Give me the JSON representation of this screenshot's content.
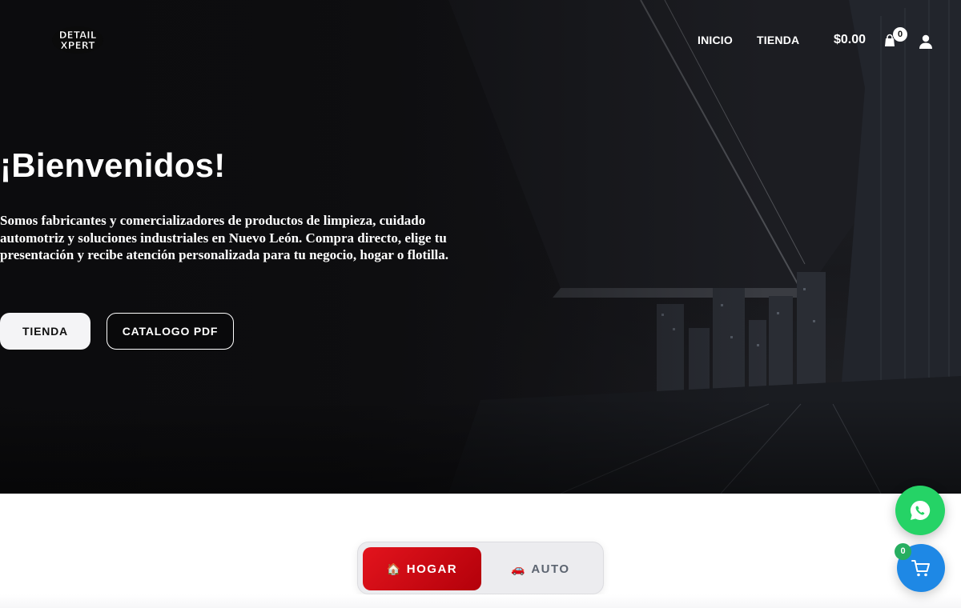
{
  "header": {
    "logo_text": "DETAIL XPERT",
    "nav": [
      {
        "label": "INICIO"
      },
      {
        "label": "TIENDA"
      }
    ],
    "cart_total": "$0.00",
    "cart_count": "0",
    "icons": [
      "shopping-bag-icon",
      "user-icon"
    ]
  },
  "hero": {
    "title": "¡Bienvenidos!",
    "description": "Somos fabricantes y comercializadores de productos de limpieza, cuidado automotriz y soluciones industriales en Nuevo León. Compra directo, elige tu presentación y recibe atención personalizada para tu negocio, hogar o flotilla.",
    "buttons": {
      "shop": "TIENDA",
      "catalog": "CATALOGO PDF"
    }
  },
  "tabs": {
    "items": [
      {
        "emoji": "🏠",
        "label": "HOGAR",
        "active": true
      },
      {
        "emoji": "🚗",
        "label": "AUTO",
        "active": false
      }
    ]
  },
  "floating": {
    "whatsapp_icon": "whatsapp-icon",
    "cart_icon": "cart-icon",
    "cart_count": "0"
  },
  "colors": {
    "accent_red": "#d60a14",
    "whatsapp_green": "#25d366",
    "cart_blue": "#1e88e5",
    "badge_green": "#27ae60"
  }
}
